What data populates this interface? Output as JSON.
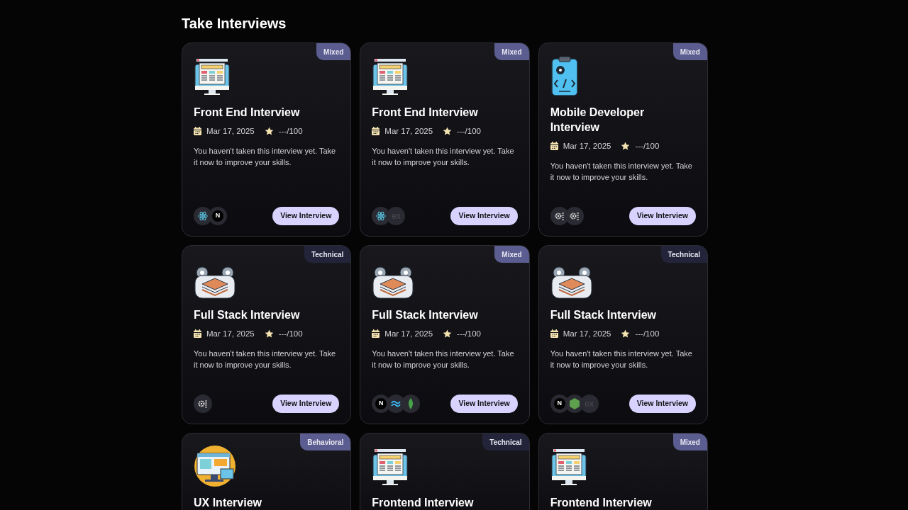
{
  "heading": "Take Interviews",
  "cards": [
    {
      "badge": {
        "label": "Mixed",
        "color": "#5b5c8f"
      },
      "kind": "web",
      "title": "Front End Interview",
      "date": "Mar 17, 2025",
      "score": "---/100",
      "description": "You haven't taken this interview yet. Take it now to improve your skills.",
      "tech": [
        {
          "kind": "react"
        },
        {
          "kind": "next",
          "label": "N"
        }
      ],
      "button": "View Interview"
    },
    {
      "badge": {
        "label": "Mixed",
        "color": "#5b5c8f"
      },
      "kind": "web",
      "title": "Front End Interview",
      "date": "Mar 17, 2025",
      "score": "---/100",
      "description": "You haven't taken this interview yet. Take it now to improve your skills.",
      "tech": [
        {
          "kind": "react"
        },
        {
          "kind": "express",
          "label": "ex"
        }
      ],
      "button": "View Interview"
    },
    {
      "badge": {
        "label": "Mixed",
        "color": "#5b5c8f"
      },
      "kind": "mobile",
      "title": "Mobile Developer Interview",
      "date": "Mar 17, 2025",
      "score": "---/100",
      "description": "You haven't taken this interview yet. Take it now to improve your skills.",
      "tech": [
        {
          "kind": "gear"
        },
        {
          "kind": "gear"
        }
      ],
      "button": "View Interview"
    },
    {
      "badge": {
        "label": "Technical",
        "color": "#23243a"
      },
      "kind": "stack",
      "title": "Full Stack Interview",
      "date": "Mar 17, 2025",
      "score": "---/100",
      "description": "You haven't taken this interview yet. Take it now to improve your skills.",
      "tech": [
        {
          "kind": "gear"
        }
      ],
      "button": "View Interview"
    },
    {
      "badge": {
        "label": "Mixed",
        "color": "#5b5c8f"
      },
      "kind": "stack",
      "title": "Full Stack Interview",
      "date": "Mar 17, 2025",
      "score": "---/100",
      "description": "You haven't taken this interview yet. Take it now to improve your skills.",
      "tech": [
        {
          "kind": "next",
          "label": "N"
        },
        {
          "kind": "tailwind"
        },
        {
          "kind": "mongo"
        }
      ],
      "button": "View Interview"
    },
    {
      "badge": {
        "label": "Technical",
        "color": "#23243a"
      },
      "kind": "stack",
      "title": "Full Stack Interview",
      "date": "Mar 17, 2025",
      "score": "---/100",
      "description": "You haven't taken this interview yet. Take it now to improve your skills.",
      "tech": [
        {
          "kind": "next",
          "label": "N"
        },
        {
          "kind": "node"
        },
        {
          "kind": "express",
          "label": "ex"
        }
      ],
      "button": "View Interview"
    },
    {
      "badge": {
        "label": "Behavioral",
        "color": "#5b5c8f"
      },
      "kind": "ux",
      "title": "UX Interview"
    },
    {
      "badge": {
        "label": "Technical",
        "color": "#23243a"
      },
      "kind": "web",
      "title": "Frontend Interview"
    },
    {
      "badge": {
        "label": "Mixed",
        "color": "#5b5c8f"
      },
      "kind": "web",
      "title": "Frontend Interview"
    }
  ]
}
